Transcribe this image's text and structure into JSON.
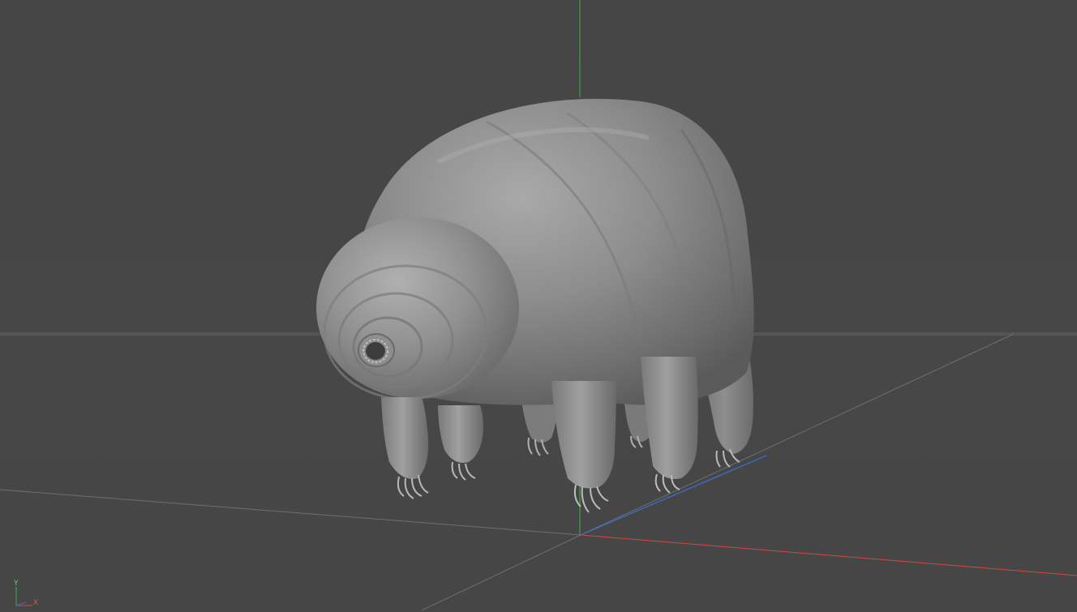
{
  "viewport": {
    "background": "#474747",
    "horizon_color": "#555555"
  },
  "axes": {
    "x_color": "#d9453f",
    "y_color": "#3fb04f",
    "z_color": "#3a6fd8",
    "grid_color": "#6a6a6a"
  },
  "model": {
    "name": "tardigrade-sculpt",
    "shading": "matcap-grey",
    "base_color": "#8c8c8c"
  },
  "gizmo": {
    "y_label": "Y",
    "x_label": "X"
  }
}
